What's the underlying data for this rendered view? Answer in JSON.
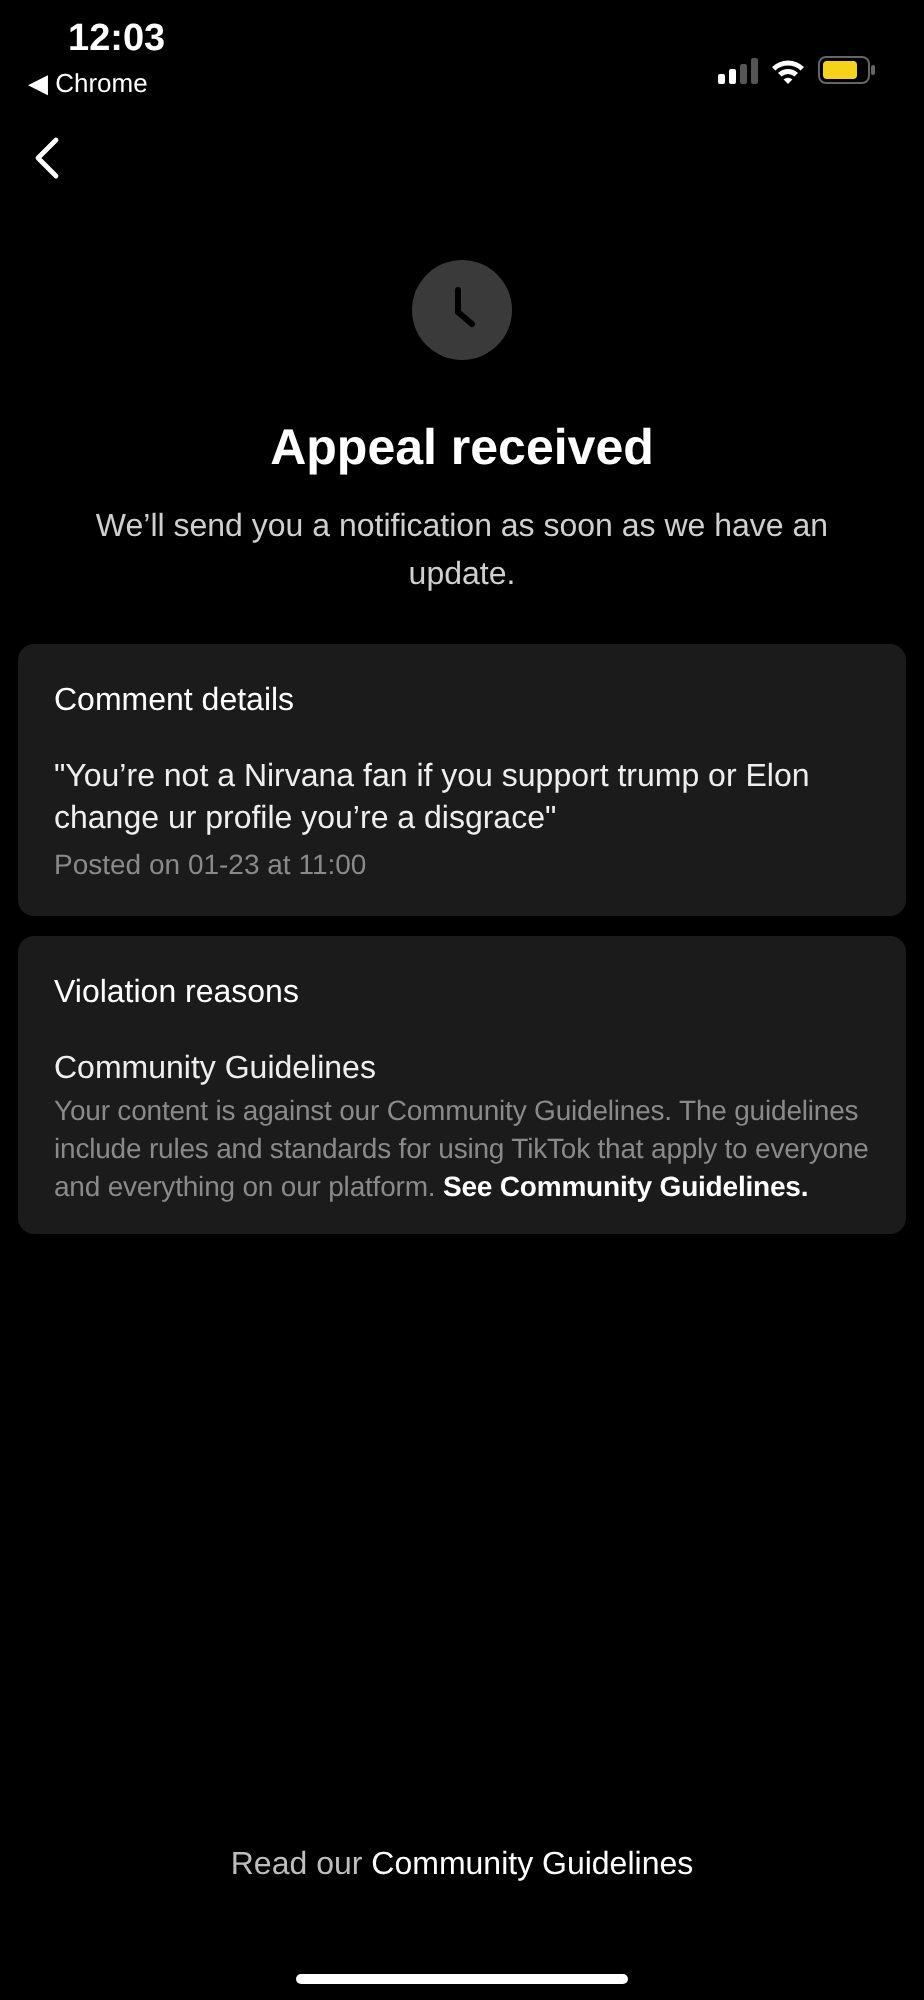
{
  "status_bar": {
    "time": "12:03",
    "back_app": "◀ Chrome"
  },
  "header": {
    "title": "Appeal received",
    "subtitle": "We’ll send you a notification as soon as we have an update."
  },
  "comment_card": {
    "title": "Comment details",
    "comment": "\"You’re not a Nirvana fan if you support trump or Elon change ur profile you’re a disgrace\"",
    "posted": "Posted on 01-23 at 11:00"
  },
  "violation_card": {
    "title": "Violation reasons",
    "reason": "Community Guidelines",
    "description": "Your content is against our Community Guidelines. The guidelines include rules and standards for using TikTok that apply to everyone and everything on our platform.",
    "link": "See Community Guidelines."
  },
  "footer": {
    "text": "Read our",
    "link": "Community Guidelines"
  }
}
